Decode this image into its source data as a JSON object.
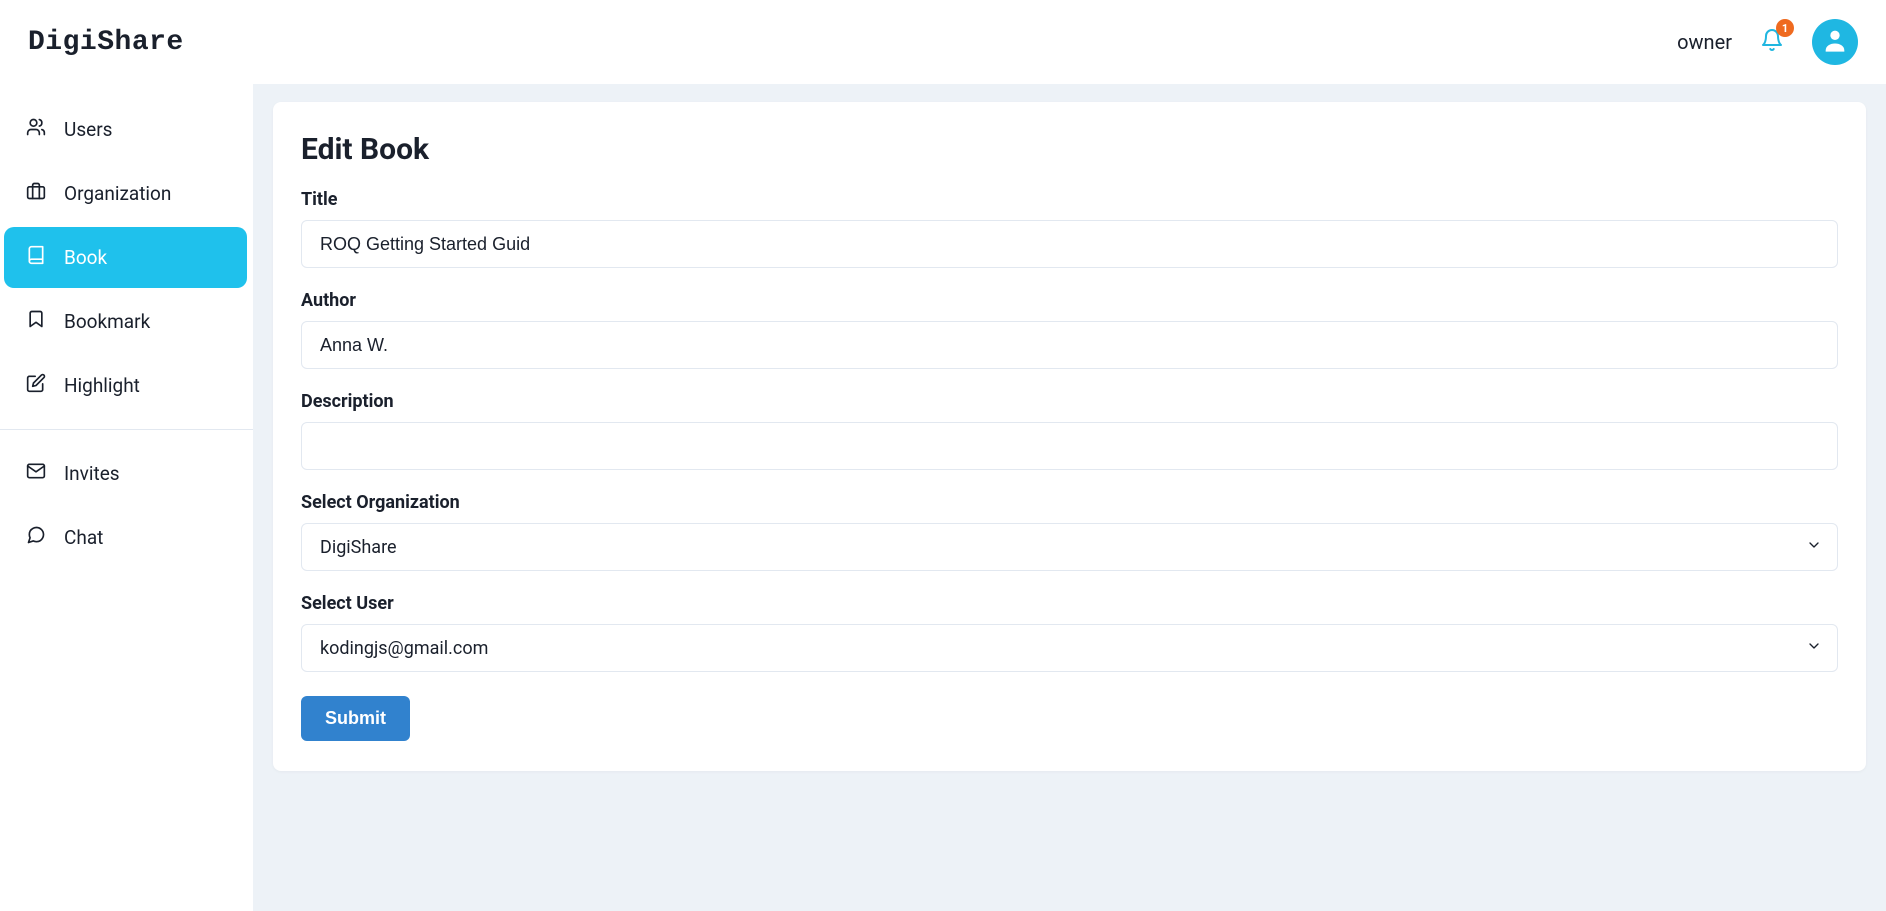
{
  "header": {
    "app_name": "DigiShare",
    "role_label": "owner",
    "notification_count": "1"
  },
  "sidebar": {
    "items": [
      {
        "label": "Users",
        "icon": "users-icon"
      },
      {
        "label": "Organization",
        "icon": "briefcase-icon"
      },
      {
        "label": "Book",
        "icon": "book-icon"
      },
      {
        "label": "Bookmark",
        "icon": "bookmark-icon"
      },
      {
        "label": "Highlight",
        "icon": "edit-icon"
      }
    ],
    "section2": [
      {
        "label": "Invites",
        "icon": "mail-icon"
      },
      {
        "label": "Chat",
        "icon": "chat-icon"
      }
    ]
  },
  "page": {
    "heading": "Edit Book",
    "labels": {
      "title": "Title",
      "author": "Author",
      "description": "Description",
      "select_org": "Select Organization",
      "select_user": "Select User"
    },
    "values": {
      "title": "ROQ Getting Started Guid",
      "author": "Anna W.",
      "description": "",
      "organization": "DigiShare",
      "user": "kodingjs@gmail.com"
    },
    "submit_label": "Submit"
  }
}
